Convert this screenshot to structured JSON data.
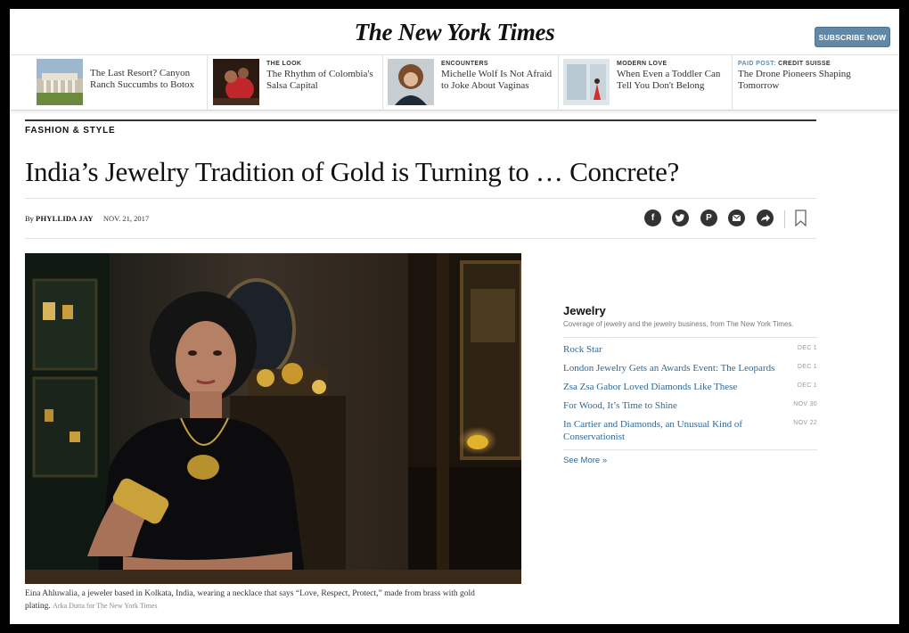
{
  "header": {
    "logo": "The New York Times",
    "subscribe_label": "SUBSCRIBE NOW"
  },
  "ribbon": [
    {
      "kicker": "",
      "headline": "The Last Resort? Canyon Ranch Succumbs to Botox"
    },
    {
      "kicker": "THE LOOK",
      "headline": "The Rhythm of Colombia's Salsa Capital"
    },
    {
      "kicker": "ENCOUNTERS",
      "headline": "Michelle Wolf Is Not Afraid to Joke About Vaginas"
    },
    {
      "kicker": "MODERN LOVE",
      "headline": "When Even a Toddler Can Tell You Don't Belong"
    },
    {
      "kicker_paid": "PAID POST:",
      "kicker": "CREDIT SUISSE",
      "headline": "The Drone Pioneers Shaping Tomorrow"
    }
  ],
  "article": {
    "section": "FASHION & STYLE",
    "headline": "India’s Jewelry Tradition of Gold is Turning to … Concrete?",
    "by": "By",
    "author": "PHYLLIDA JAY",
    "date": "NOV. 21, 2017",
    "caption": "Eina Ahluwalia, a jeweler based in Kolkata, India, wearing a necklace that says “Love, Respect, Protect,” made from brass with gold plating.",
    "credit": "Arka Dutta for The New York Times"
  },
  "share_icons": [
    "facebook-icon",
    "twitter-icon",
    "pinterest-icon",
    "email-icon",
    "share-icon"
  ],
  "sidebar": {
    "title": "Jewelry",
    "description": "Coverage of jewelry and the jewelry business, from The New York Times.",
    "items": [
      {
        "title": "Rock Star",
        "date": "DEC 1"
      },
      {
        "title": "London Jewelry Gets an Awards Event: The Leopards",
        "date": "DEC 1"
      },
      {
        "title": "Zsa Zsa Gabor Loved Diamonds Like These",
        "date": "DEC 1"
      },
      {
        "title": "For Wood, It’s Time to Shine",
        "date": "NOV 30"
      },
      {
        "title": "In Cartier and Diamonds, an Unusual Kind of Conservationist",
        "date": "NOV 22"
      }
    ],
    "see_more": "See More »"
  },
  "colors": {
    "subscribe_bg": "#6288a5",
    "link_blue": "#326891",
    "paid_post_blue": "#6288a5"
  }
}
